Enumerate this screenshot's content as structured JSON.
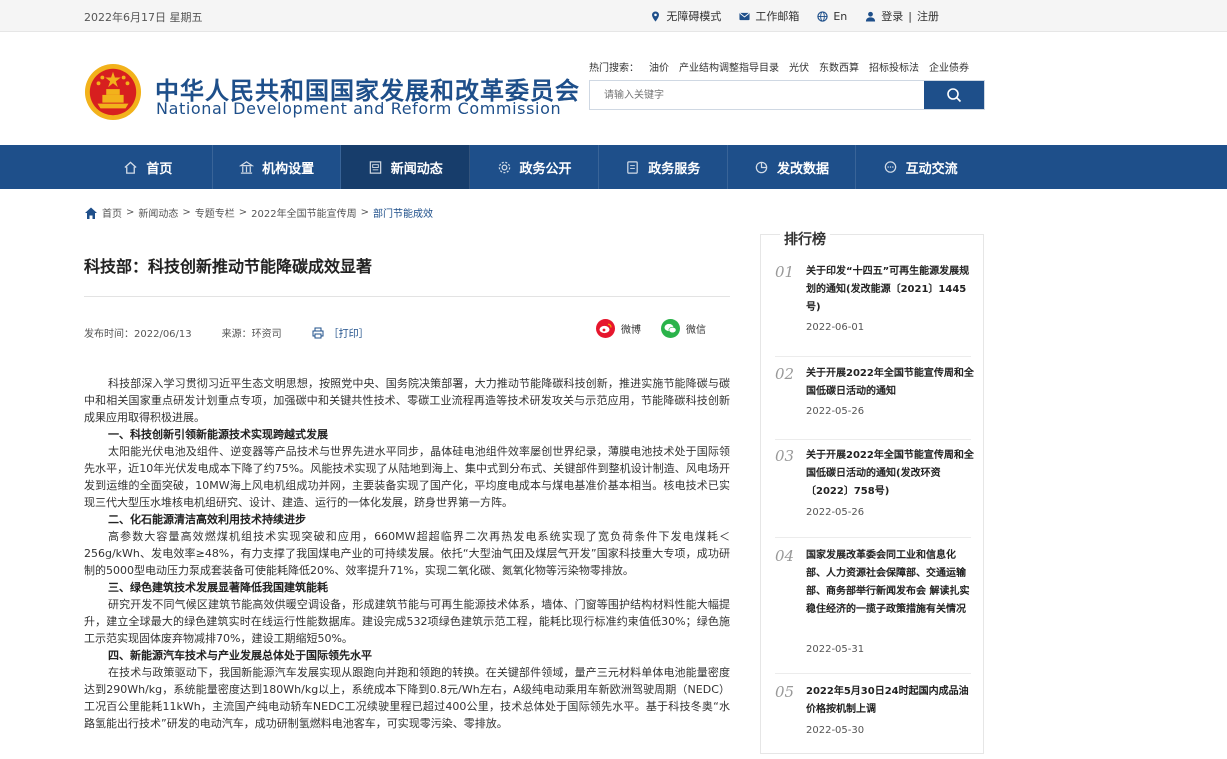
{
  "topbar": {
    "date": "2022年6月17日 星期五",
    "accessibility": "无障碍模式",
    "workmail": "工作邮箱",
    "lang": "En",
    "login": "登录",
    "divider": "|",
    "register": "注册"
  },
  "header": {
    "title_cn": "中华人民共和国国家发展和改革委员会",
    "title_en": "National Development and Reform Commission",
    "hot_label": "热门搜索：",
    "hot_items": [
      "油价",
      "产业结构调整指导目录",
      "光伏",
      "东数西算",
      "招标投标法",
      "企业债券"
    ],
    "search_placeholder": "请输入关键字"
  },
  "nav": {
    "items": [
      {
        "label": "首页",
        "icon": "home-icon"
      },
      {
        "label": "机构设置",
        "icon": "building-icon"
      },
      {
        "label": "新闻动态",
        "icon": "news-icon",
        "active": true
      },
      {
        "label": "政务公开",
        "icon": "gear-icon"
      },
      {
        "label": "政务服务",
        "icon": "document-icon"
      },
      {
        "label": "发改数据",
        "icon": "pie-chart-icon"
      },
      {
        "label": "互动交流",
        "icon": "chat-icon"
      }
    ]
  },
  "breadcrumb": {
    "items": [
      "首页",
      "新闻动态",
      "专题专栏",
      "2022年全国节能宣传周"
    ],
    "current": "部门节能成效",
    "sep": ">"
  },
  "article": {
    "title": "科技部：科技创新推动节能降碳成效显著",
    "publish_time": "发布时间：2022/06/13",
    "source": "来源：环资司",
    "print": "［打印］",
    "share_weibo": "微博",
    "share_wechat": "微信",
    "paragraphs": [
      {
        "type": "p",
        "text": "科技部深入学习贯彻习近平生态文明思想，按照党中央、国务院决策部署，大力推动节能降碳科技创新，推进实施节能降碳与碳中和相关国家重点研发计划重点专项，加强碳中和关键共性技术、零碳工业流程再造等技术研发攻关与示范应用，节能降碳科技创新成果应用取得积极进展。"
      },
      {
        "type": "h",
        "text": "一、科技创新引领新能源技术实现跨越式发展"
      },
      {
        "type": "p",
        "text": "太阳能光伏电池及组件、逆变器等产品技术与世界先进水平同步，晶体硅电池组件效率屡创世界纪录，薄膜电池技术处于国际领先水平，近10年光伏发电成本下降了约75%。风能技术实现了从陆地到海上、集中式到分布式、关键部件到整机设计制造、风电场开发到运维的全面突破，10MW海上风电机组成功并网，主要装备实现了国产化，平均度电成本与煤电基准价基本相当。核电技术已实现三代大型压水堆核电机组研究、设计、建造、运行的一体化发展，跻身世界第一方阵。"
      },
      {
        "type": "h",
        "text": "二、化石能源清洁高效利用技术持续进步"
      },
      {
        "type": "p",
        "text": "高参数大容量高效燃煤机组技术实现突破和应用，660MW超超临界二次再热发电系统实现了宽负荷条件下发电煤耗＜256g/kWh、发电效率≥48%，有力支撑了我国煤电产业的可持续发展。依托“大型油气田及煤层气开发”国家科技重大专项，成功研制的5000型电动压力泵成套装备可使能耗降低20%、效率提升71%，实现二氧化碳、氮氧化物等污染物零排放。"
      },
      {
        "type": "h",
        "text": "三、绿色建筑技术发展显著降低我国建筑能耗"
      },
      {
        "type": "p",
        "text": "研究开发不同气候区建筑节能高效供暖空调设备，形成建筑节能与可再生能源技术体系，墙体、门窗等围护结构材料性能大幅提升，建立全球最大的绿色建筑实时在线运行性能数据库。建设完成532项绿色建筑示范工程，能耗比现行标准约束值低30%；绿色施工示范实现固体废弃物减排70%，建设工期缩短50%。"
      },
      {
        "type": "h",
        "text": "四、新能源汽车技术与产业发展总体处于国际领先水平"
      },
      {
        "type": "p",
        "text": "在技术与政策驱动下，我国新能源汽车发展实现从跟跑向并跑和领跑的转换。在关键部件领域，量产三元材料单体电池能量密度达到290Wh/kg，系统能量密度达到180Wh/kg以上，系统成本下降到0.8元/Wh左右，A级纯电动乘用车新欧洲驾驶周期（NEDC）工况百公里能耗11kWh，主流国产纯电动轿车NEDC工况续驶里程已超过400公里，技术总体处于国际领先水平。基于科技冬奥“水路氢能出行技术”研发的电动汽车，成功研制氢燃料电池客车，可实现零污染、零排放。"
      }
    ]
  },
  "ranking": {
    "title": "排行榜",
    "items": [
      {
        "num": "01",
        "title": "关于印发“十四五”可再生能源发展规划的通知(发改能源〔2021〕1445号)",
        "date": "2022-06-01"
      },
      {
        "num": "02",
        "title": "关于开展2022年全国节能宣传周和全国低碳日活动的通知",
        "date": "2022-05-26"
      },
      {
        "num": "03",
        "title": "关于开展2022年全国节能宣传周和全国低碳日活动的通知(发改环资〔2022〕758号)",
        "date": "2022-05-26"
      },
      {
        "num": "04",
        "title": "国家发展改革委会同工业和信息化部、人力资源社会保障部、交通运输部、商务部举行新闻发布会 解读扎实稳住经济的一揽子政策措施有关情况",
        "date": "2022-05-31"
      },
      {
        "num": "05",
        "title": "2022年5月30日24时起国内成品油价格按机制上调",
        "date": "2022-05-30"
      }
    ]
  },
  "colors": {
    "brand": "#1e4f8a",
    "nav_active": "#173d6b",
    "weibo": "#e6162d",
    "wechat": "#2ab34a"
  }
}
